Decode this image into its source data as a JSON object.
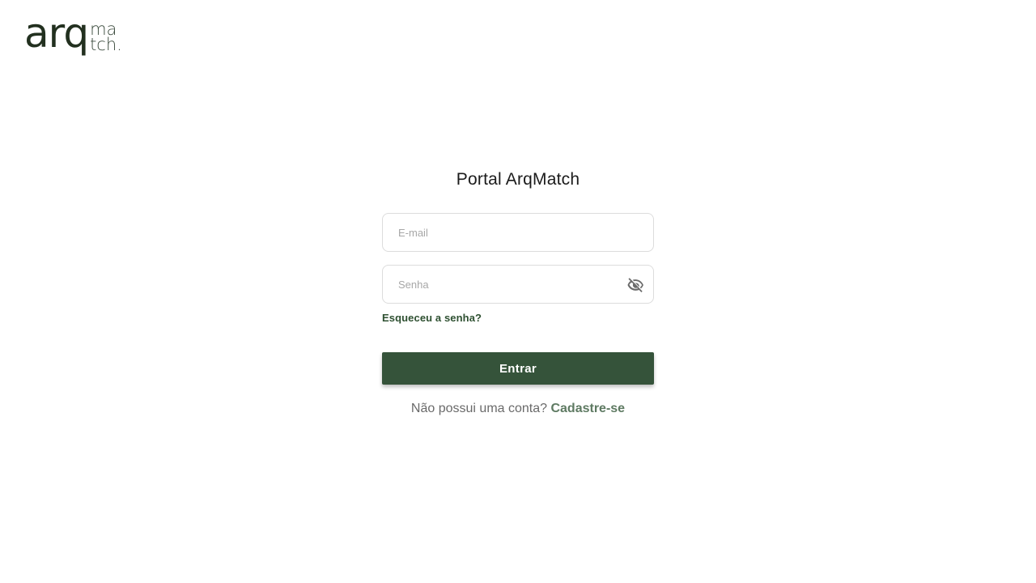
{
  "logo": {
    "main": "arq",
    "line1": "ma",
    "line2": "tch."
  },
  "form": {
    "title": "Portal ArqMatch",
    "email_placeholder": "E-mail",
    "password_placeholder": "Senha",
    "forgot_label": "Esqueceu a senha?",
    "submit_label": "Entrar",
    "signup_prompt": "Não possui uma conta?",
    "signup_link": "Cadastre-se"
  },
  "icons": {
    "password_toggle": "eye-off-icon"
  },
  "colors": {
    "primary": "#35533a",
    "link": "#2e5031",
    "signup_link": "#5e7a62"
  }
}
